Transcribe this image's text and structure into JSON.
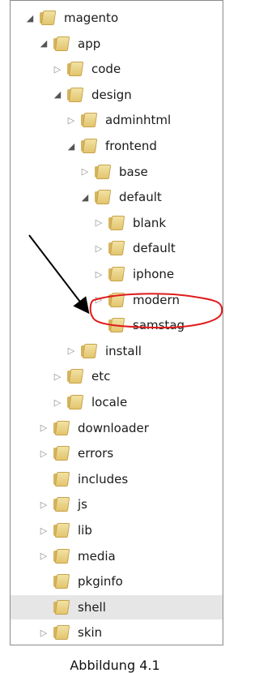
{
  "tree": {
    "items": [
      {
        "label": "magento",
        "depth": 0,
        "expander": "expanded"
      },
      {
        "label": "app",
        "depth": 1,
        "expander": "expanded"
      },
      {
        "label": "code",
        "depth": 2,
        "expander": "collapsed"
      },
      {
        "label": "design",
        "depth": 2,
        "expander": "expanded"
      },
      {
        "label": "adminhtml",
        "depth": 3,
        "expander": "collapsed"
      },
      {
        "label": "frontend",
        "depth": 3,
        "expander": "expanded"
      },
      {
        "label": "base",
        "depth": 4,
        "expander": "collapsed"
      },
      {
        "label": "default",
        "depth": 4,
        "expander": "expanded"
      },
      {
        "label": "blank",
        "depth": 5,
        "expander": "collapsed"
      },
      {
        "label": "default",
        "depth": 5,
        "expander": "collapsed"
      },
      {
        "label": "iphone",
        "depth": 5,
        "expander": "collapsed"
      },
      {
        "label": "modern",
        "depth": 5,
        "expander": "collapsed"
      },
      {
        "label": "samstag",
        "depth": 5,
        "expander": "none",
        "highlighted": true
      },
      {
        "label": "install",
        "depth": 3,
        "expander": "collapsed"
      },
      {
        "label": "etc",
        "depth": 2,
        "expander": "collapsed"
      },
      {
        "label": "locale",
        "depth": 2,
        "expander": "collapsed"
      },
      {
        "label": "downloader",
        "depth": 1,
        "expander": "collapsed"
      },
      {
        "label": "errors",
        "depth": 1,
        "expander": "collapsed"
      },
      {
        "label": "includes",
        "depth": 1,
        "expander": "none"
      },
      {
        "label": "js",
        "depth": 1,
        "expander": "collapsed"
      },
      {
        "label": "lib",
        "depth": 1,
        "expander": "collapsed"
      },
      {
        "label": "media",
        "depth": 1,
        "expander": "collapsed"
      },
      {
        "label": "pkginfo",
        "depth": 1,
        "expander": "none"
      },
      {
        "label": "shell",
        "depth": 1,
        "expander": "none",
        "selected": true
      },
      {
        "label": "skin",
        "depth": 1,
        "expander": "collapsed"
      }
    ]
  },
  "icons": {
    "expanded": "triangle-down-icon",
    "collapsed": "triangle-right-icon",
    "folder": "folder-icon"
  },
  "colors": {
    "selected_bg": "#e6e6e6",
    "annotation_red": "#e01b1b",
    "arrow_black": "#000000"
  },
  "caption": "Abbildung 4.1"
}
